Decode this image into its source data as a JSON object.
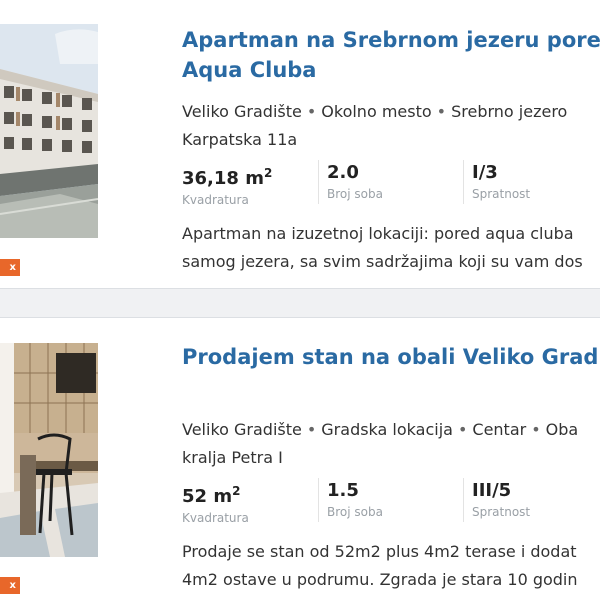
{
  "listings": [
    {
      "title_lines": [
        "Apartman na Srebrnom jezeru pored",
        "Aqua Cluba"
      ],
      "location": [
        "Veliko Gradište",
        "Okolno mesto",
        "Srebrno jezero"
      ],
      "street": "Karpatska 11a",
      "area_value": "36,18 m",
      "area_sup": "2",
      "area_label": "Kvadratura",
      "rooms_value": "2.0",
      "rooms_label": "Broj soba",
      "floor_value": "I/3",
      "floor_label": "Spratnost",
      "desc_lines": [
        "Apartman na izuzetnoj lokaciji: pored aqua cluba",
        "samog jezera, sa svim sadržajima koji su vam dos"
      ],
      "badge": "x"
    },
    {
      "title_lines": [
        "Prodajem stan na obali Veliko Gradiš"
      ],
      "location": [
        "Veliko Gradište",
        "Gradska lokacija",
        "Centar",
        "Oba"
      ],
      "street": "kralja Petra I",
      "area_value": "52 m",
      "area_sup": "2",
      "area_label": "Kvadratura",
      "rooms_value": "1.5",
      "rooms_label": "Broj soba",
      "floor_value": "III/5",
      "floor_label": "Spratnost",
      "desc_lines": [
        "Prodaje se stan od 52m2 plus 4m2 terase i dodat",
        "4m2 ostave u podrumu. Zgrada je stara 10 godin"
      ],
      "badge": "x"
    }
  ],
  "colors": {
    "title": "#2a6aa3",
    "badge": "#e8672a",
    "label": "#9aa0a6",
    "separator": "#f0f1f3"
  }
}
